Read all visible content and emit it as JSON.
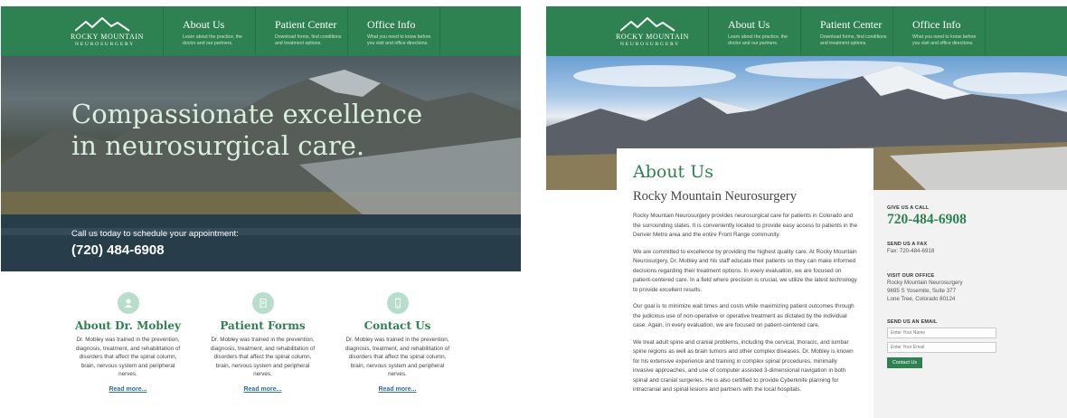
{
  "brand": {
    "name_line1": "ROCKY MOUNTAIN",
    "name_line2": "NEUROSURGERY"
  },
  "nav": [
    {
      "title": "About Us",
      "desc": "Learn about the practice, the doctor and our partners."
    },
    {
      "title": "Patient Center",
      "desc": "Download forms, find conditions and treatment options."
    },
    {
      "title": "Office Info",
      "desc": "What you need to know before you visit and office directions."
    }
  ],
  "home": {
    "hero_title": "Compassionate excellence in neurosurgical care.",
    "hero_cta": "Call us today to schedule your appointment:",
    "hero_phone": "(720) 484-6908",
    "features": [
      {
        "title": "About Dr. Mobley",
        "icon": "person-icon",
        "desc": "Dr. Mobley was trained in the prevention, diagnosis, treatment, and rehabilitation of disorders that affect the spinal column, brain, nervous system and peripheral nerves.",
        "link": "Read more..."
      },
      {
        "title": "Patient Forms",
        "icon": "document-icon",
        "desc": "Dr. Mobley was trained in the prevention, diagnosis, treatment, and rehabilitation of disorders that affect the spinal column, brain, nervous system and peripheral nerves.",
        "link": "Read more..."
      },
      {
        "title": "Contact Us",
        "icon": "phone-icon",
        "desc": "Dr. Mobley was trained in the prevention, diagnosis, treatment, and rehabilitation of disorders that affect the spinal column, brain, nervous system and peripheral nerves.",
        "link": "Read more..."
      }
    ]
  },
  "about": {
    "heading": "About Us",
    "subheading": "Rocky Mountain Neurosurgery",
    "paragraphs": [
      "Rocky Mountain Neurosurgery provides neurosurgical care for patients in Colorado and the surrounding states.  It is conveniently located to provide easy access to patients in the Denver Metro area and the entire Front Range community.",
      "We are committed to excellence by providing the highest quality care. At Rocky Mountain Neurosurgery, Dr. Mobley and his staff educate their patients so they can make informed decisions regarding their treatment options. In every evaluation, we are focused on patient-centered care.  In a field where precision is crucial, we utilize the latest technology to provide excellent results.",
      "Our goal is to minimize wait times and costs while maximizing patient outcomes through the judicious use of non-operative or operative treatment as dictated by the individual case.  Again, in every evaluation, we are focused on patient-centered care.",
      "We treat adult spine and cranial problems, including the cervical, thoracic, and lumbar spine regions as well as brain tumors and other complex diseases.  Dr. Mobley is known for his extensive experience and training in complex spinal procedures, minimally invasive approaches, and use of computer assisted 3-dimensional navigation in both spinal and cranial surgeries.  He is also certified to provide Cyberknife planning for intracranial and spinal lesions and partners with the local hospitals."
    ]
  },
  "sidebar": {
    "call_heading": "GIVE US A CALL",
    "phone": "720-484-6908",
    "fax_heading": "SEND US A FAX",
    "fax": "Fax: 720-484-6918",
    "office_heading": "VISIT OUR OFFICE",
    "office_lines": [
      "Rocky Mountain Neurosurgery",
      "9695 S Yosemite, Suite 377",
      "Lone Tree, Colorado 80124"
    ],
    "email_heading": "SEND US AN EMAIL",
    "name_placeholder": "Enter Your Name",
    "email_placeholder": "Enter Your Email",
    "button": "Contact Us"
  },
  "colors": {
    "brand_green": "#2e8150",
    "icon_mint": "#b7decc",
    "link_blue": "#2a6f9a",
    "sidebar_bg": "#f1f2f1"
  }
}
